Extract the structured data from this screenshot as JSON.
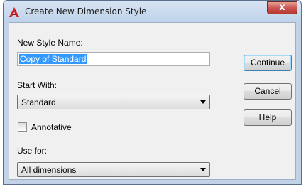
{
  "window": {
    "title": "Create New Dimension Style",
    "close_symbol": "x"
  },
  "form": {
    "new_style_name_label": "New Style Name:",
    "new_style_name_value": "Copy of Standard",
    "start_with_label": "Start With:",
    "start_with_value": "Standard",
    "annotative_label": "Annotative",
    "annotative_checked": false,
    "use_for_label": "Use for:",
    "use_for_value": "All dimensions"
  },
  "buttons": {
    "continue": "Continue",
    "cancel": "Cancel",
    "help": "Help"
  },
  "icons": {
    "app": "autocad-icon",
    "close": "close-icon",
    "dropdown": "chevron-down-icon"
  },
  "colors": {
    "selection": "#3399ff",
    "close_button": "#c75050",
    "app_icon": "#d21f1f"
  }
}
